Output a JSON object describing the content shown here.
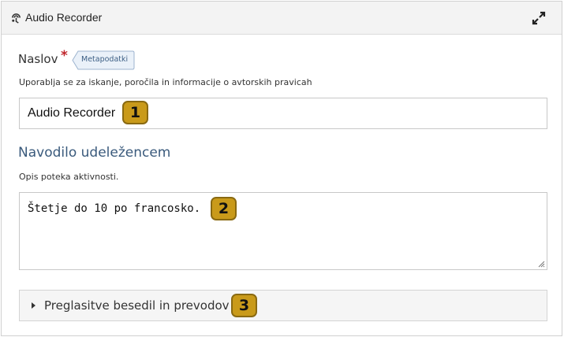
{
  "header": {
    "title": "Audio Recorder",
    "icon": "audio-recorder-icon",
    "expand_icon": "expand-icon"
  },
  "title_field": {
    "label": "Naslov",
    "required_marker": "*",
    "metadata_button": "Metapodatki",
    "description": "Uporablja se za iskanje, poročila in informacije o avtorskih pravicah",
    "value": "Audio Recorder"
  },
  "instructions": {
    "heading": "Navodilo udeležencem",
    "description": "Opis poteka aktivnosti.",
    "value": "Štetje do 10 po francosko."
  },
  "collapsible": {
    "label": "Preglasitve besedil in prevodov"
  },
  "badges": [
    "1",
    "2",
    "3"
  ],
  "colors": {
    "header_bg": "#f3f3f3",
    "heading": "#3a5a7c",
    "required": "#c0262c",
    "badge_bg": "#c99a1a"
  }
}
